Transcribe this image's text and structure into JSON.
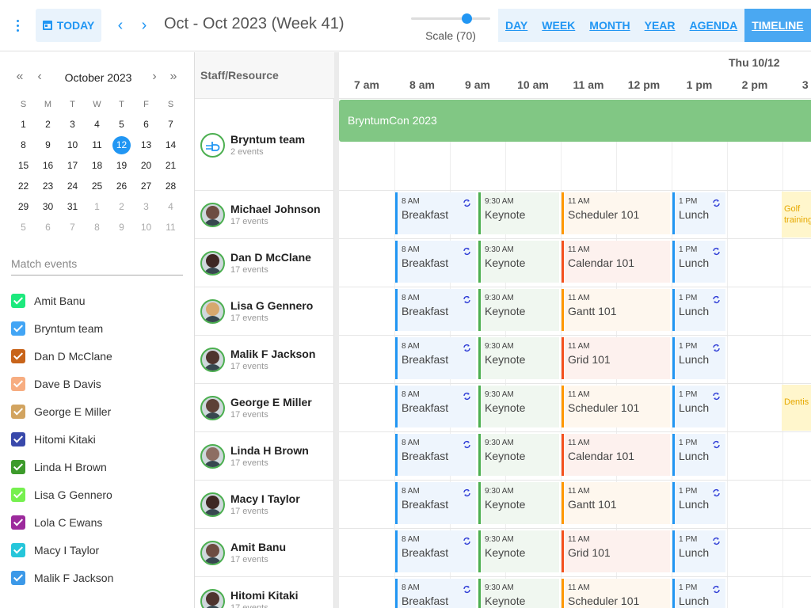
{
  "toolbar": {
    "today_label": "TODAY",
    "prev_icon": "‹",
    "next_icon": "›",
    "period_title": "Oct - Oct 2023 (Week 41)",
    "scale_label": "Scale (70)",
    "scale_value": 70,
    "views": [
      {
        "label": "DAY",
        "active": false
      },
      {
        "label": "WEEK",
        "active": false
      },
      {
        "label": "MONTH",
        "active": false
      },
      {
        "label": "YEAR",
        "active": false
      },
      {
        "label": "AGENDA",
        "active": false
      },
      {
        "label": "TIMELINE",
        "active": true
      }
    ]
  },
  "mini_calendar": {
    "title": "October 2023",
    "prev_year": "«",
    "prev_month": "‹",
    "next_month": "›",
    "next_year": "»",
    "dow": [
      "S",
      "M",
      "T",
      "W",
      "T",
      "F",
      "S"
    ],
    "days": [
      [
        "1",
        "2",
        "3",
        "4",
        "5",
        "6",
        "7"
      ],
      [
        "8",
        "9",
        "10",
        "11",
        "12",
        "13",
        "14"
      ],
      [
        "15",
        "16",
        "17",
        "18",
        "19",
        "20",
        "21"
      ],
      [
        "22",
        "23",
        "24",
        "25",
        "26",
        "27",
        "28"
      ],
      [
        "29",
        "30",
        "31",
        "1",
        "2",
        "3",
        "4"
      ],
      [
        "5",
        "6",
        "7",
        "8",
        "9",
        "10",
        "11"
      ]
    ],
    "selected": "12"
  },
  "filter": {
    "placeholder": "Match events",
    "value": ""
  },
  "resources_filter": [
    {
      "name": "Amit Banu",
      "color": "#1de97d"
    },
    {
      "name": "Bryntum team",
      "color": "#42a5f5"
    },
    {
      "name": "Dan D McClane",
      "color": "#c8641a"
    },
    {
      "name": "Dave B Davis",
      "color": "#f7ad81"
    },
    {
      "name": "George E Miller",
      "color": "#d2a460"
    },
    {
      "name": "Hitomi Kitaki",
      "color": "#3949ab"
    },
    {
      "name": "Linda H Brown",
      "color": "#3d9b2b"
    },
    {
      "name": "Lisa G Gennero",
      "color": "#76f04f"
    },
    {
      "name": "Lola C Ewans",
      "color": "#9c2a9c"
    },
    {
      "name": "Macy I Taylor",
      "color": "#26c6da"
    },
    {
      "name": "Malik F Jackson",
      "color": "#3c99e8"
    }
  ],
  "timeline": {
    "column_header": "Staff/Resource",
    "date_header": "Thu 10/12",
    "hours": [
      "7 am",
      "8 am",
      "9 am",
      "10 am",
      "11 am",
      "12 pm",
      "1 pm",
      "2 pm",
      "3 p"
    ],
    "allday_event": "BryntumCon 2023",
    "rows": [
      {
        "name": "Bryntum team",
        "count": "2 events",
        "avatar": "bryntum",
        "events": []
      },
      {
        "name": "Michael Johnson",
        "count": "17 events",
        "avatar": "#6d4c41",
        "events": [
          {
            "time": "8 AM",
            "name": "Breakfast",
            "kind": "blue",
            "recurring": true
          },
          {
            "time": "9:30 AM",
            "name": "Keynote",
            "kind": "green",
            "recurring": false
          },
          {
            "time": "11 AM",
            "name": "Scheduler 101",
            "kind": "orange",
            "recurring": false
          },
          {
            "time": "1 PM",
            "name": "Lunch",
            "kind": "blue",
            "recurring": true
          }
        ],
        "extra": "Golf training"
      },
      {
        "name": "Dan D McClane",
        "count": "17 events",
        "avatar": "#3e2723",
        "events": [
          {
            "time": "8 AM",
            "name": "Breakfast",
            "kind": "blue",
            "recurring": true
          },
          {
            "time": "9:30 AM",
            "name": "Keynote",
            "kind": "green",
            "recurring": false
          },
          {
            "time": "11 AM",
            "name": "Calendar 101",
            "kind": "red",
            "recurring": false
          },
          {
            "time": "1 PM",
            "name": "Lunch",
            "kind": "blue",
            "recurring": true
          }
        ]
      },
      {
        "name": "Lisa G Gennero",
        "count": "17 events",
        "avatar": "#d7a86e",
        "events": [
          {
            "time": "8 AM",
            "name": "Breakfast",
            "kind": "blue",
            "recurring": true
          },
          {
            "time": "9:30 AM",
            "name": "Keynote",
            "kind": "green",
            "recurring": false
          },
          {
            "time": "11 AM",
            "name": "Gantt 101",
            "kind": "orange",
            "recurring": false
          },
          {
            "time": "1 PM",
            "name": "Lunch",
            "kind": "blue",
            "recurring": true
          }
        ]
      },
      {
        "name": "Malik F Jackson",
        "count": "17 events",
        "avatar": "#4e342e",
        "events": [
          {
            "time": "8 AM",
            "name": "Breakfast",
            "kind": "blue",
            "recurring": true
          },
          {
            "time": "9:30 AM",
            "name": "Keynote",
            "kind": "green",
            "recurring": false
          },
          {
            "time": "11 AM",
            "name": "Grid 101",
            "kind": "red",
            "recurring": false
          },
          {
            "time": "1 PM",
            "name": "Lunch",
            "kind": "blue",
            "recurring": true
          }
        ]
      },
      {
        "name": "George E Miller",
        "count": "17 events",
        "avatar": "#5d4037",
        "events": [
          {
            "time": "8 AM",
            "name": "Breakfast",
            "kind": "blue",
            "recurring": true
          },
          {
            "time": "9:30 AM",
            "name": "Keynote",
            "kind": "green",
            "recurring": false
          },
          {
            "time": "11 AM",
            "name": "Scheduler 101",
            "kind": "orange",
            "recurring": false
          },
          {
            "time": "1 PM",
            "name": "Lunch",
            "kind": "blue",
            "recurring": true
          }
        ],
        "extra": "Dentis"
      },
      {
        "name": "Linda H Brown",
        "count": "17 events",
        "avatar": "#8d6e63",
        "events": [
          {
            "time": "8 AM",
            "name": "Breakfast",
            "kind": "blue",
            "recurring": true
          },
          {
            "time": "9:30 AM",
            "name": "Keynote",
            "kind": "green",
            "recurring": false
          },
          {
            "time": "11 AM",
            "name": "Calendar 101",
            "kind": "red",
            "recurring": false
          },
          {
            "time": "1 PM",
            "name": "Lunch",
            "kind": "blue",
            "recurring": true
          }
        ]
      },
      {
        "name": "Macy I Taylor",
        "count": "17 events",
        "avatar": "#3e2723",
        "events": [
          {
            "time": "8 AM",
            "name": "Breakfast",
            "kind": "blue",
            "recurring": true
          },
          {
            "time": "9:30 AM",
            "name": "Keynote",
            "kind": "green",
            "recurring": false
          },
          {
            "time": "11 AM",
            "name": "Gantt 101",
            "kind": "orange",
            "recurring": false
          },
          {
            "time": "1 PM",
            "name": "Lunch",
            "kind": "blue",
            "recurring": true
          }
        ]
      },
      {
        "name": "Amit Banu",
        "count": "17 events",
        "avatar": "#6d4c41",
        "events": [
          {
            "time": "8 AM",
            "name": "Breakfast",
            "kind": "blue",
            "recurring": true
          },
          {
            "time": "9:30 AM",
            "name": "Keynote",
            "kind": "green",
            "recurring": false
          },
          {
            "time": "11 AM",
            "name": "Grid 101",
            "kind": "red",
            "recurring": false
          },
          {
            "time": "1 PM",
            "name": "Lunch",
            "kind": "blue",
            "recurring": true
          }
        ]
      },
      {
        "name": "Hitomi Kitaki",
        "count": "17 events",
        "avatar": "#4e342e",
        "events": [
          {
            "time": "8 AM",
            "name": "Breakfast",
            "kind": "blue",
            "recurring": true
          },
          {
            "time": "9:30 AM",
            "name": "Keynote",
            "kind": "green",
            "recurring": false
          },
          {
            "time": "11 AM",
            "name": "Scheduler 101",
            "kind": "orange",
            "recurring": false
          },
          {
            "time": "1 PM",
            "name": "Lunch",
            "kind": "blue",
            "recurring": true
          }
        ]
      }
    ]
  },
  "colors": {
    "accent": "#2196f3",
    "event_blue_bg": "#eef5fd",
    "event_blue_border": "#2196f3",
    "event_green_bg": "#f0f7f0",
    "event_green_border": "#4caf50",
    "event_orange_bg": "#fef7ee",
    "event_orange_border": "#ff9800",
    "event_red_bg": "#fdf1ee",
    "event_red_border": "#f4511e",
    "allday_bg": "#81c784"
  }
}
